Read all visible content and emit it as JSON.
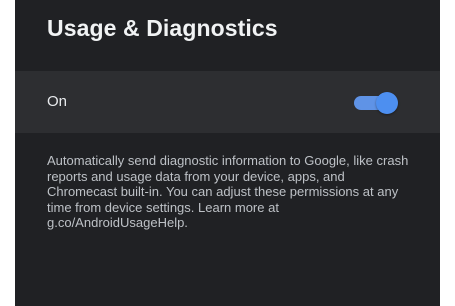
{
  "header": {
    "title": "Usage & Diagnostics"
  },
  "setting": {
    "label": "On",
    "toggle_state": "on",
    "toggle_color": "#4d8ff0"
  },
  "description": {
    "text": "Automatically send diagnostic information to Google, like crash reports and usage data from your device, apps, and Chromecast built-in. You can adjust these permissions at any time from device settings. Learn more at g.co/AndroidUsageHelp."
  }
}
